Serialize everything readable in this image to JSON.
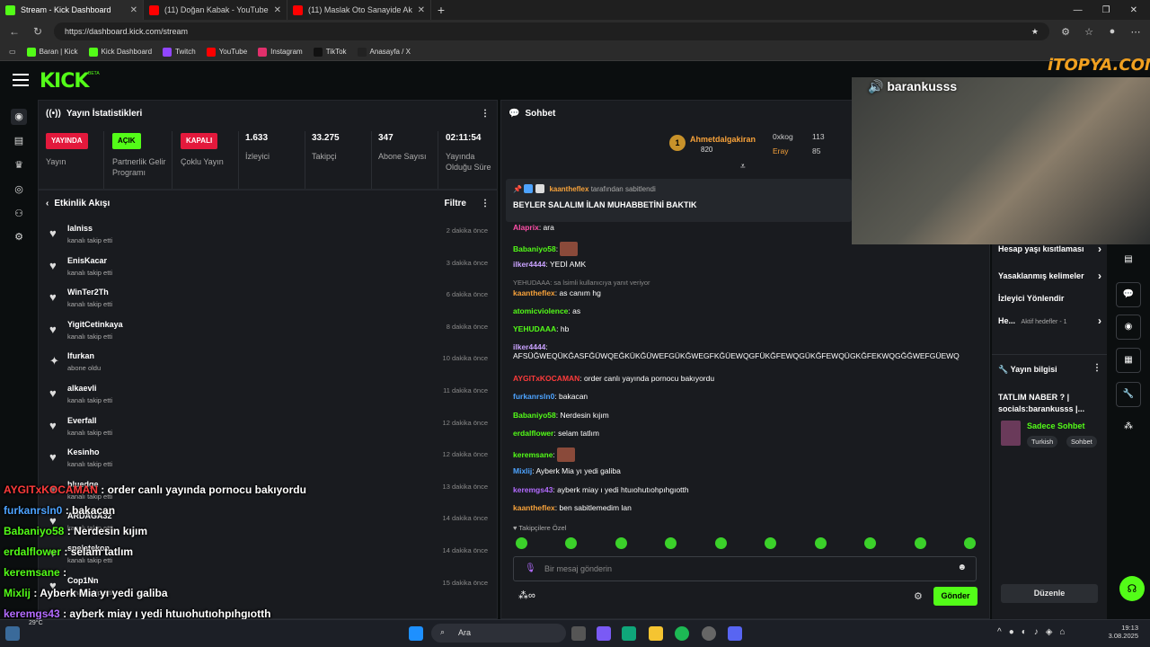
{
  "browser": {
    "tabs": [
      {
        "label": "Stream - Kick Dashboard",
        "color": "#53fc18"
      },
      {
        "label": "(11) Doğan Kabak - YouTube",
        "color": "#ff0000"
      },
      {
        "label": "(11) Maslak Oto Sanayide Akülü …",
        "color": "#ff0000"
      }
    ],
    "url": "https://dashboard.kick.com/stream",
    "bookmarks": [
      {
        "label": "Baran | Kick",
        "color": "#53fc18"
      },
      {
        "label": "Kick Dashboard",
        "color": "#53fc18"
      },
      {
        "label": "Twitch",
        "color": "#9146ff"
      },
      {
        "label": "YouTube",
        "color": "#ff0000"
      },
      {
        "label": "Instagram",
        "color": "#e1306c"
      },
      {
        "label": "TikTok",
        "color": "#111111"
      },
      {
        "label": "Anasayfa / X",
        "color": "#222222"
      }
    ]
  },
  "brand": {
    "logo": "KICK",
    "beta": "BETA"
  },
  "stats": {
    "title": "Yayın İstatistikleri",
    "items": [
      {
        "badge": "YAYINDA",
        "label": "Yayın"
      },
      {
        "badge": "AÇIK",
        "label": "Partnerlik Gelir Programı"
      },
      {
        "badge": "KAPALI",
        "label": "Çoklu Yayın"
      },
      {
        "value": "1.633",
        "label": "İzleyici"
      },
      {
        "value": "33.275",
        "label": "Takipçi"
      },
      {
        "value": "347",
        "label": "Abone Sayısı"
      },
      {
        "value": "02:11:54",
        "label": "Yayında Olduğu Süre"
      }
    ]
  },
  "activity": {
    "title": "Etkinlik Akışı",
    "filter": "Filtre",
    "items": [
      {
        "name": "lalniss",
        "sub": "kanalı takip etti",
        "time": "2 dakika önce"
      },
      {
        "name": "EnisKacar",
        "sub": "kanalı takip etti",
        "time": "3 dakika önce"
      },
      {
        "name": "WinTer2Th",
        "sub": "kanalı takip etti",
        "time": "6 dakika önce"
      },
      {
        "name": "YigitCetinkaya",
        "sub": "kanalı takip etti",
        "time": "8 dakika önce"
      },
      {
        "name": "Ifurkan",
        "sub": "abone oldu",
        "time": "10 dakika önce"
      },
      {
        "name": "alkaevli",
        "sub": "kanalı takip etti",
        "time": "11 dakika önce"
      },
      {
        "name": "Everfall",
        "sub": "kanalı takip etti",
        "time": "12 dakika önce"
      },
      {
        "name": "Kesinho",
        "sub": "kanalı takip etti",
        "time": "12 dakika önce"
      },
      {
        "name": "bluedge",
        "sub": "kanalı takip etti",
        "time": "13 dakika önce"
      },
      {
        "name": "ARDAGA32",
        "sub": "kanalı takip etti",
        "time": "14 dakika önce"
      },
      {
        "name": "spelatekon",
        "sub": "kanalı takip etti",
        "time": "14 dakika önce"
      },
      {
        "name": "Cop1Nn",
        "sub": "kanalı takip etti",
        "time": "15 dakika önce"
      }
    ]
  },
  "chat": {
    "title": "Sohbet",
    "leaders": {
      "first": "Ahmetdalgakiran",
      "first_count": "820",
      "second": "0xkog",
      "second_count": "113",
      "third": "Eray",
      "third_count": "85"
    },
    "pinned_by": "kaantheflex",
    "pinned_by_suffix": "tarafından sabitlendi",
    "pinned_text": "BEYLER SALALIM İLAN MUHABBETİNİ BAKTIK",
    "messages": [
      {
        "user": "Alaprix",
        "color": "#ff4fa8",
        "text": ": ara"
      },
      {
        "user": "Babaniyo58",
        "color": "#53fc18",
        "text": ":",
        "emote": true
      },
      {
        "user": "ilker4444",
        "color": "#c9a2ff",
        "text": ": YEDİ AMK"
      },
      {
        "user": "kaantheflex",
        "color": "#f7a23a",
        "text": ": as canım hg",
        "reply": "YEHUDAAA: sa lsimli kullanıcıya yanıt veriyor"
      },
      {
        "user": "atomicviolence",
        "color": "#53fc18",
        "text": ": as"
      },
      {
        "user": "YEHUDAAA",
        "color": "#53fc18",
        "text": ": hb"
      },
      {
        "user": "ilker4444",
        "color": "#c9a2ff",
        "text": ":",
        "line2": "AFSÜĞWEQÜKĞASFĞÜWQEĞKÜKĞÜWEFGÜKĞWEGFKĞÜEWQGFÜKĞFEWQGÜKĞFEWQÜGKĞFEKWQGĞĞWEFGÜEWQ"
      },
      {
        "user": "AYGITxKOCAMAN",
        "color": "#ff3b3b",
        "text": ": order canlı yayında pornocu bakıyordu"
      },
      {
        "user": "furkanrsln0",
        "color": "#4da3ff",
        "text": ": bakacan"
      },
      {
        "user": "Babaniyo58",
        "color": "#53fc18",
        "text": ": Nerdesin kıjım"
      },
      {
        "user": "erdalflower",
        "color": "#53fc18",
        "text": ": selam tatlım"
      },
      {
        "user": "keremsane",
        "color": "#53fc18",
        "text": ":",
        "emote": true
      },
      {
        "user": "Mixlij",
        "color": "#4da3ff",
        "text": ": Ayberk Mia yı yedi galiba"
      },
      {
        "user": "keremgs43",
        "color": "#b36bff",
        "text": ": ayberk miay ı yedi htuıohutıohpıhgıotth"
      },
      {
        "user": "kaantheflex",
        "color": "#f7a23a",
        "text": ": ben sabitlemedim lan"
      }
    ],
    "followers_only": "Takipçilere Özel",
    "placeholder": "Bir mesaj gönderin",
    "send": "Gönder"
  },
  "right": {
    "items": [
      "Hesap yaşı kısıtlaması",
      "Yasaklanmış kelimeler",
      "İzleyici Yönlendir",
      "He..."
    ],
    "goal": "Aktif hedefler - 1",
    "info_title": "Yayın bilgisi",
    "stream_title": "TATLIM NABER ? | socials:barankusss |...",
    "category": "Sadece Sohbet",
    "tags": [
      "Turkish",
      "Sohbet"
    ],
    "edit": "Düzenle"
  },
  "video": {
    "channel": "barankusss",
    "watermark": "iTOPYA.COM"
  },
  "overlay": [
    {
      "user": "AYGITxKOCAMAN",
      "color": "#ff3b3b",
      "text": ": order canlı yayında pornocu bakıyordu"
    },
    {
      "user": "furkanrsln0",
      "color": "#4da3ff",
      "text": ": bakacan"
    },
    {
      "user": "Babaniyo58",
      "color": "#53fc18",
      "text": ": Nerdesin kıjım"
    },
    {
      "user": "erdalflower",
      "color": "#53fc18",
      "text": ": selam tatlım"
    },
    {
      "user": "keremsane",
      "color": "#53fc18",
      "text": ":"
    },
    {
      "user": "Mixlij",
      "color": "#53fc18",
      "text": ": Ayberk Mia yı yedi galiba"
    },
    {
      "user": "keremgs43",
      "color": "#b36bff",
      "text": ": ayberk miay ı yedi htuıohutıohpıhgıotth"
    },
    {
      "user": "kaantheflex",
      "color": "#f7a23a",
      "text": ": ben sabitlemedim lan"
    }
  ],
  "taskbar": {
    "search": "Ara",
    "temp": "29°C",
    "time": "19:13",
    "date": "3.08.2025"
  }
}
